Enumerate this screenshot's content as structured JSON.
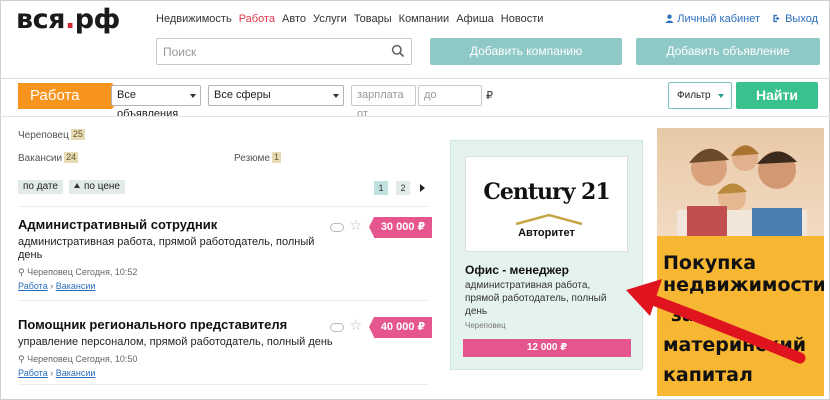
{
  "logo": {
    "main": "вся",
    "dot": ".",
    "tld": "рф"
  },
  "nav": [
    "Недвижимость",
    "Работа",
    "Авто",
    "Услуги",
    "Товары",
    "Компании",
    "Афиша",
    "Новости"
  ],
  "nav_active": "Работа",
  "account": {
    "cabinet": "Личный кабинет",
    "logout": "Выход"
  },
  "search": {
    "placeholder": "Поиск"
  },
  "buttons": {
    "add_company": "Добавить компанию",
    "add_ad": "Добавить объявление",
    "filter": "Фильтр",
    "find": "Найти"
  },
  "filters": {
    "section": "Работа",
    "ads": "Все объявления",
    "spheres": "Все сферы",
    "salary_from": "зарплата от",
    "salary_to": "до",
    "currency": "₽"
  },
  "left": {
    "city": "Череповец",
    "city_count": "25",
    "vacancies": "Вакансии",
    "vacancies_count": "24",
    "resume": "Резюме",
    "resume_count": "1",
    "sort_date": "по дате",
    "sort_price": "по цене",
    "pages": [
      "1",
      "2"
    ]
  },
  "jobs": [
    {
      "title": "Административный сотрудник",
      "desc": "административная работа, прямой работодатель, полный день",
      "meta": "Череповец Сегодня, 10:52",
      "crumb1": "Работа",
      "crumb2": "Вакансии",
      "price": "30 000 ₽"
    },
    {
      "title": "Помощник регионального представителя",
      "desc": "управление персоналом, прямой работодатель, полный день",
      "meta": "Череповец Сегодня, 10:50",
      "crumb1": "Работа",
      "crumb2": "Вакансии",
      "price": "40 000 ₽"
    }
  ],
  "ad": {
    "logo_word": "Century 21",
    "logo_sub": "Авторитет",
    "title": "Офис - менеджер",
    "desc": "административная работа, прямой работодатель, полный день",
    "city": "Череповец",
    "price": "12 000 ₽"
  },
  "banner": {
    "line1": "Покупка",
    "line2": "недвижимости",
    "line3": "за",
    "line4": "материнский",
    "line5": "капитал"
  },
  "colors": {
    "accent_orange": "#f7941e",
    "teal": "#8fc9c7",
    "green": "#39c28e",
    "pink": "#e6568e",
    "arrow_red": "#e0141e"
  }
}
